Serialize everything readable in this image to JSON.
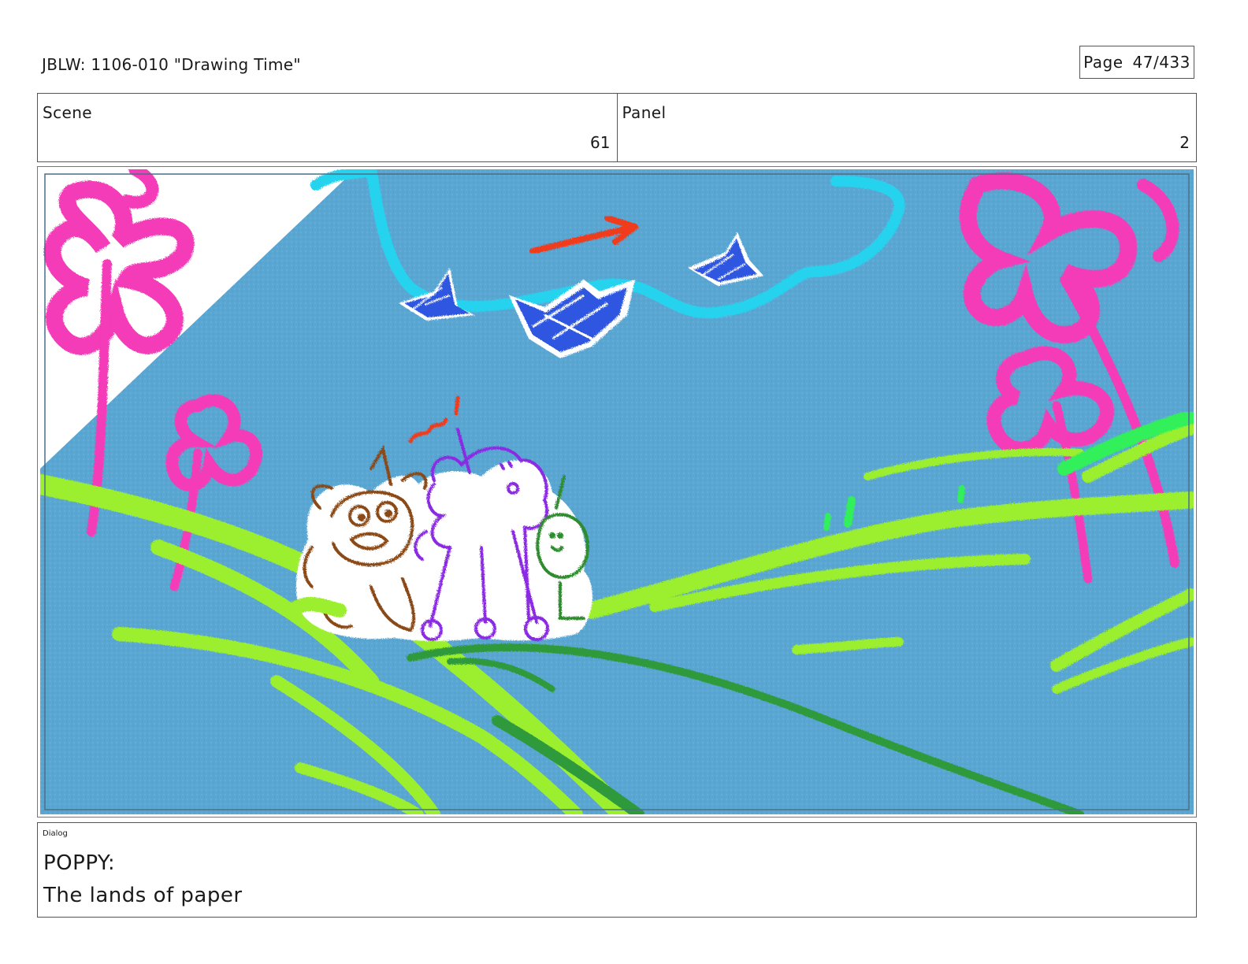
{
  "header": {
    "title": "JBLW: 1106-010 \"Drawing Time\"",
    "page_label": "Page",
    "page_number": "47/433"
  },
  "meta": {
    "scene_label": "Scene",
    "scene_value": "61",
    "panel_label": "Panel",
    "panel_value": "2"
  },
  "panel": {
    "colors": {
      "sky": "#5aa6d2",
      "cloud_outline": "#27d3ee",
      "flowers": "#f43ab8",
      "grass": "#9bef2e",
      "dark_grass": "#2d9a3a",
      "cranes": "#2d57e0",
      "arrow": "#f03a1e"
    },
    "icons": [
      "paper-crane-icon",
      "direction-arrow-icon",
      "flower-icon"
    ]
  },
  "dialog": {
    "label": "Dialog",
    "speaker": "POPPY:",
    "line": "The lands of paper"
  }
}
